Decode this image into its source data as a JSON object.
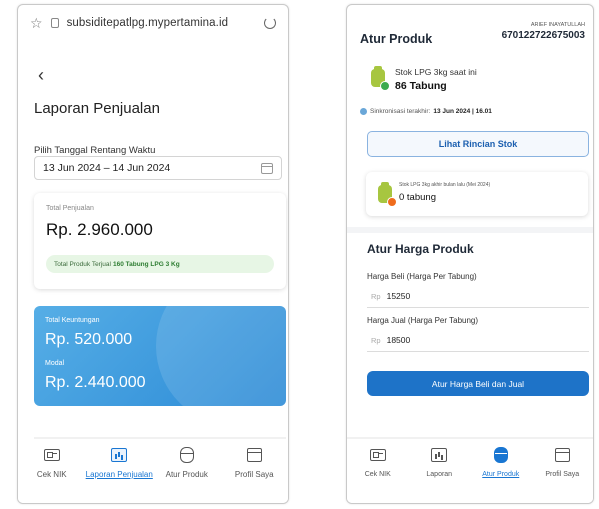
{
  "left": {
    "url": "subsiditepatlpg.mypertamina.id",
    "back_icon": "chevron-left-icon",
    "title": "Laporan Penjualan",
    "date_range_label": "Pilih Tanggal Rentang Waktu",
    "date_range_value": "13 Jun 2024 – 14 Jun 2024",
    "sales": {
      "label": "Total Penjualan",
      "amount": "Rp. 2.960.000",
      "products_label": "Total Produk Terjual",
      "products_value": "160 Tabung LPG 3 Kg"
    },
    "profit": {
      "label": "Total Keuntungan",
      "amount": "Rp. 520.000",
      "capital_label": "Modal",
      "capital_amount": "Rp. 2.440.000"
    },
    "nav": [
      {
        "label": "Cek NIK",
        "icon": "id-card-icon"
      },
      {
        "label": "Laporan Penjualan",
        "icon": "chart-icon"
      },
      {
        "label": "Atur Produk",
        "icon": "gas-tank-icon"
      },
      {
        "label": "Profil Saya",
        "icon": "store-icon"
      }
    ],
    "active_nav": "Laporan Penjualan"
  },
  "right": {
    "title": "Atur Produk",
    "user_name": "ARIEF INAYATULLAH",
    "user_id": "670122722675003",
    "stock_label": "Stok LPG 3kg saat ini",
    "stock_value": "86 Tabung",
    "sync_label": "Sinkronisasi terakhir:",
    "sync_value": "13 Jun 2024 | 16.01",
    "stock_details_button": "Lihat Rincian Stok",
    "last_month_label": "Stok LPG 3kg akhir bulan lalu (Mei 2024)",
    "last_month_value": "0 tabung",
    "price_section_title": "Atur Harga Produk",
    "buy_price_label": "Harga Beli (Harga Per Tabung)",
    "buy_price_value": "15250",
    "sell_price_label": "Harga Jual (Harga Per Tabung)",
    "sell_price_value": "18500",
    "currency_prefix": "Rp",
    "submit_button": "Atur Harga Beli dan Jual",
    "nav": [
      {
        "label": "Cek NIK",
        "icon": "id-card-icon"
      },
      {
        "label": "Laporan",
        "icon": "chart-icon"
      },
      {
        "label": "Atur Produk",
        "icon": "gas-tank-icon"
      },
      {
        "label": "Profil Saya",
        "icon": "store-icon"
      }
    ],
    "active_nav": "Atur Produk"
  },
  "colors": {
    "accent_blue": "#1976d2",
    "card_gradient_start": "#56aee6",
    "card_gradient_end": "#2b8ad6",
    "success_green": "#2e7d32",
    "button_blue": "#1e73c8"
  }
}
